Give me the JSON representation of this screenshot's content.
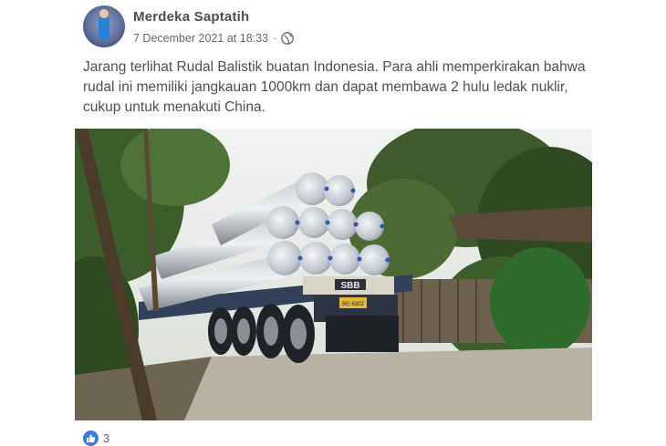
{
  "post": {
    "author": "Merdeka Saptatih",
    "date": "7 December 2021 at 18:33",
    "separator": "·",
    "privacy_icon": "globe-icon",
    "text": "Jarang terlihat Rudal Balistik buatan Indonesia. Para ahli memperkirakan bahwa rudal ini memiliki jangkauan 1000km dan dapat membawa 2 hulu ledak nuklir, cukup untuk menakuti China.",
    "photo": {
      "truck_plate": "SBB",
      "license_plate": "BG 8302"
    },
    "reactions": {
      "icon": "like-icon",
      "count": "3"
    }
  },
  "colors": {
    "text": "#4b4f56",
    "meta": "#606770",
    "like_blue": "#3b7de0"
  }
}
